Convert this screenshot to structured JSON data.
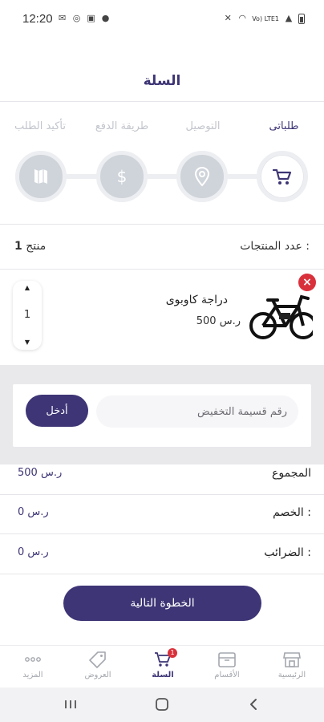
{
  "status_bar": {
    "time": "12:20",
    "network_label": "Vo) LTE1"
  },
  "header": {
    "title": "السلة"
  },
  "steps": [
    {
      "label": "طلباتى",
      "icon": "cart-icon",
      "active": true
    },
    {
      "label": "التوصيل",
      "icon": "location-pin-icon",
      "active": false
    },
    {
      "label": "طريقة الدفع",
      "icon": "dollar-icon",
      "active": false
    },
    {
      "label": "تأكيد الطلب",
      "icon": "map-icon",
      "active": false
    }
  ],
  "cart": {
    "count_label": "عدد المنتجات :",
    "count_number": "1",
    "count_unit": "منتج"
  },
  "product": {
    "name": "دراجة كاوبوى",
    "price": "500 ر.س",
    "quantity": "1",
    "remove_symbol": "×"
  },
  "coupon": {
    "placeholder": "رقم قسيمة التخفيض",
    "apply_label": "أدخل"
  },
  "summary": [
    {
      "label": "المجموع",
      "value": "500 ر.س"
    },
    {
      "label": "الخصم :",
      "value": "0 ر.س"
    },
    {
      "label": "الضرائب :",
      "value": "0 ر.س"
    }
  ],
  "next_button": {
    "label": "الخطوة التالية"
  },
  "bottom_nav": [
    {
      "label": "الرئيسية",
      "icon": "store-icon",
      "active": false
    },
    {
      "label": "الأقسام",
      "icon": "box-icon",
      "active": false
    },
    {
      "label": "السلة",
      "icon": "cart-icon",
      "active": true,
      "badge": "1"
    },
    {
      "label": "العروض",
      "icon": "tag-icon",
      "active": false
    },
    {
      "label": "المزيد",
      "icon": "more-dots-icon",
      "active": false
    }
  ],
  "colors": {
    "primary": "#3d3575",
    "danger": "#d9313b",
    "inactive": "#cfd4da"
  }
}
